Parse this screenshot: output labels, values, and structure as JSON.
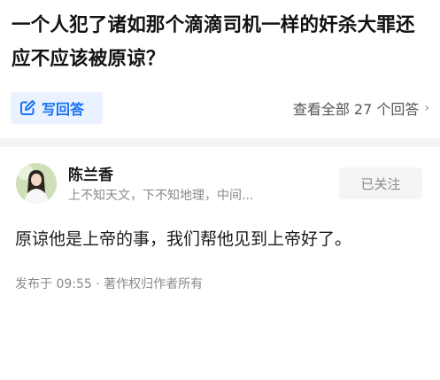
{
  "question": {
    "title": "一个人犯了诸如那个滴滴司机一样的奸杀大罪还应不应该被原谅？"
  },
  "actions": {
    "write_answer_label": "写回答",
    "view_all_label": "查看全部 27 个回答",
    "view_all_chevron": "›"
  },
  "answer": {
    "author_name": "陈兰香",
    "author_bio": "上不知天文，下不知地理，中间...",
    "follow_label": "已关注",
    "content": "原谅他是上帝的事，我们帮他见到上帝好了。",
    "meta": "发布于 09:55 · 著作权归作者所有"
  },
  "colors": {
    "accent": "#1772f6",
    "accent_bg": "#eaf2ff",
    "muted": "#8a8a8a",
    "divider": "#f2f3f5"
  },
  "icons": {
    "write": "pencil-square-icon",
    "chevron": "chevron-right-icon",
    "avatar": "user-avatar"
  }
}
